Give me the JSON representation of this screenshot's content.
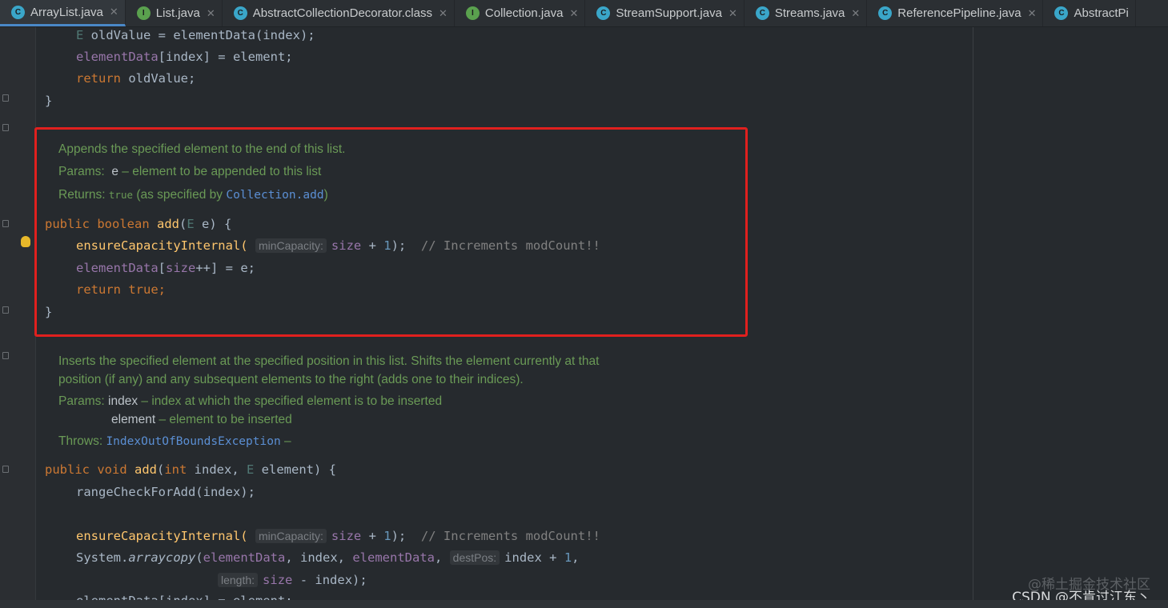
{
  "tabs": [
    {
      "label": "ArrayList.java",
      "icon": "class-icon",
      "closable": true,
      "active": true
    },
    {
      "label": "List.java",
      "icon": "interface-icon",
      "closable": true
    },
    {
      "label": "AbstractCollectionDecorator.class",
      "icon": "class-icon",
      "closable": true
    },
    {
      "label": "Collection.java",
      "icon": "interface-icon",
      "closable": true
    },
    {
      "label": "StreamSupport.java",
      "icon": "class-icon",
      "closable": true
    },
    {
      "label": "Streams.java",
      "icon": "class-icon",
      "closable": true
    },
    {
      "label": "ReferencePipeline.java",
      "icon": "class-icon",
      "closable": true
    },
    {
      "label": "AbstractPi",
      "icon": "class-icon",
      "closable": false
    }
  ],
  "code_top": {
    "l1_type": "E",
    "l1_rest": " oldValue = elementData(index);",
    "l2_field": "elementData",
    "l2_rest": "[index] = element;",
    "l3_kw": "return",
    "l3_rest": " oldValue;",
    "l4": "}"
  },
  "doc1": {
    "summary": "Appends the specified element to the end of this list.",
    "params_label": "Params:",
    "param_name": "e",
    "param_desc": "– element to be appended to this list",
    "returns_label": "Returns:",
    "returns_code": "true",
    "returns_text": "(as specified by",
    "returns_link": "Collection.add",
    "returns_close": ")"
  },
  "method1": {
    "mod": "public boolean",
    "name": "add",
    "open": "(",
    "ptype": "E",
    "rest": " e) {",
    "call1": "ensureCapacityInternal(",
    "hint1": "minCapacity:",
    "arg1_field": "size",
    "arg1_rest": " + ",
    "arg1_num": "1",
    "arg1_end": ");",
    "comment1": "// Increments modCount!!",
    "assign_field1": "elementData",
    "assign_mid": "[",
    "assign_field2": "size",
    "assign_rest": "++] = e;",
    "ret_kw": "return",
    "ret_val": "true;",
    "close": "}"
  },
  "doc2": {
    "summary1": "Inserts the specified element at the specified position in this list. Shifts the element currently at that",
    "summary2": "position (if any) and any subsequent elements to the right (adds one to their indices).",
    "params_label": "Params:",
    "p1_name": "index",
    "p1_desc": "– index at which the specified element is to be inserted",
    "p2_name": "element",
    "p2_desc": "– element to be inserted",
    "throws_label": "Throws:",
    "throws_link": "IndexOutOfBoundsException",
    "throws_dash": "–"
  },
  "method2": {
    "mod": "public void",
    "name": "add",
    "open": "(",
    "int_kw": "int",
    "index_param": " index, ",
    "ptype": "E",
    "rest": " element) {",
    "call_range": "rangeCheckForAdd(index);",
    "call1": "ensureCapacityInternal(",
    "hint1": "minCapacity:",
    "arg1_field": "size",
    "arg1_rest": " + ",
    "arg1_num": "1",
    "arg1_end": ");",
    "comment1": "// Increments modCount!!",
    "sys": "System.",
    "arraycopy": "arraycopy",
    "ac_open": "(",
    "ac_f1": "elementData",
    "ac_mid": ", index, ",
    "ac_f2": "elementData",
    "ac_comma": ",",
    "hint_dest": "destPos:",
    "ac_dest": "index + ",
    "ac_num": "1",
    "ac_end": ",",
    "hint_len": "length:",
    "len_field": "size",
    "len_rest": " - index);",
    "partial": "elementData[index] = element;"
  },
  "watermark": {
    "line1": "@稀土掘金技术社区",
    "line2": "CSDN @不肯过江东丶"
  },
  "colors": {
    "keyword": "#cc7832",
    "function": "#ffc66d",
    "field": "#9876aa",
    "number": "#6897bb",
    "doc": "#6a9a56",
    "highlight_box": "#e0201e"
  }
}
